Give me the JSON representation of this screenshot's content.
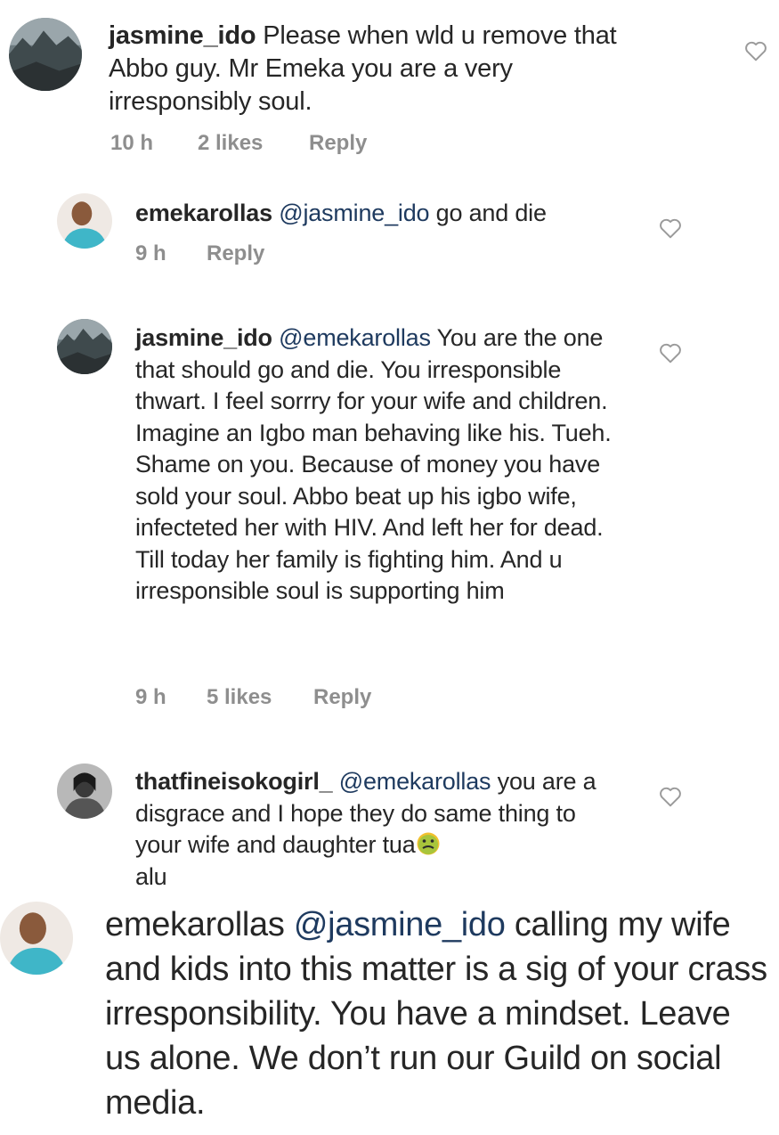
{
  "colors": {
    "text": "#262626",
    "mention": "#1e3a5f",
    "meta": "#8e8e8e",
    "heart": "#9a9a9a"
  },
  "comments": [
    {
      "username": "jasmine_ido",
      "mention": "",
      "text": "Please when wld u remove that Abbo guy. Mr Emeka you are a very irresponsibly soul.",
      "time": "10 h",
      "likes": "2 likes",
      "reply": "Reply",
      "avatar_icon": "landscape-avatar"
    },
    {
      "username": "emekarollas",
      "mention": "@jasmine_ido",
      "text": "go and die",
      "time": "9 h",
      "likes": "",
      "reply": "Reply",
      "avatar_icon": "person-avatar"
    },
    {
      "username": "jasmine_ido",
      "mention": "@emekarollas",
      "text": "You are the one that should go and die. You irresponsible thwart. I feel sorrry for your wife and children. Imagine an Igbo man behaving like his. Tueh. Shame on you. Because of money you have sold your soul. Abbo beat up his igbo wife, infecteted her with HIV. And left her for dead. Till today her family is fighting him. And u irresponsible soul is supporting him",
      "time": "9 h",
      "likes": "5 likes",
      "reply": "Reply",
      "avatar_icon": "landscape-avatar"
    },
    {
      "username": "thatfineisokogirl_",
      "mention": "@emekarollas",
      "text": "you are a disgrace and I hope they do same thing to your wife and daughter tua",
      "text_after": "alu",
      "emoji": "nauseated-face-emoji",
      "avatar_icon": "person-bw-avatar"
    },
    {
      "username": "emekarollas",
      "mention": "@jasmine_ido",
      "text": "calling my wife and kids into this matter is a sig of your crass irresponsibility. You have a mindset. Leave us alone. We don’t run our Guild on social media.",
      "avatar_icon": "person-avatar"
    }
  ]
}
